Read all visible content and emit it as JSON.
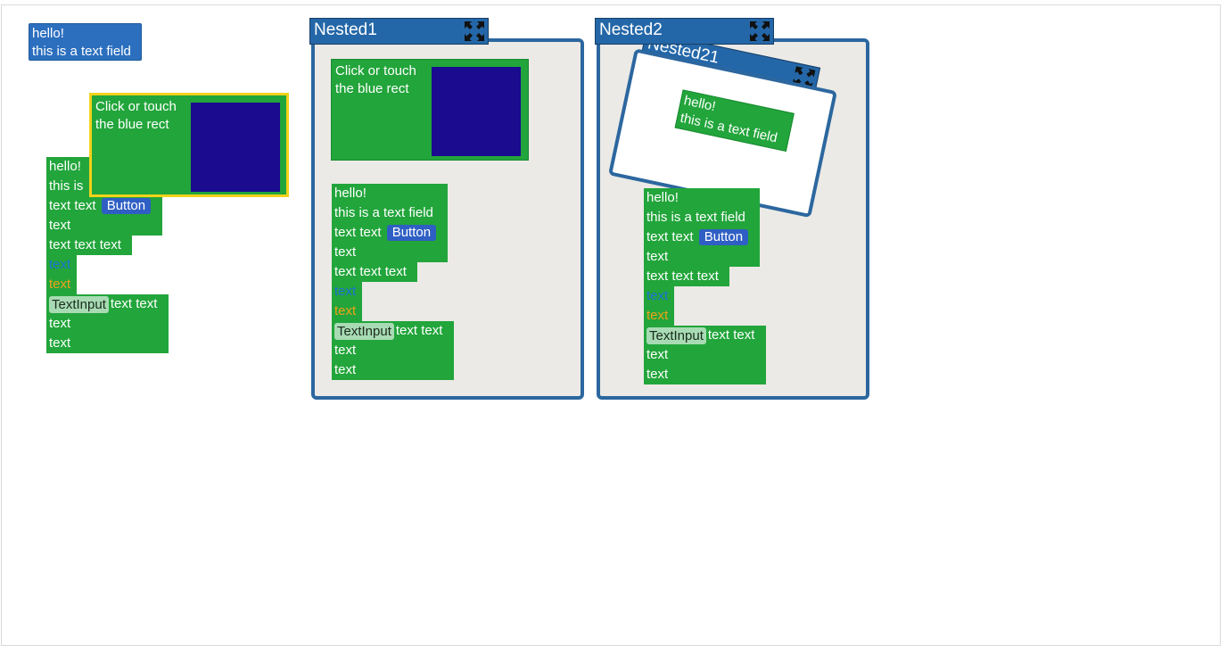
{
  "textfield": {
    "line1": "hello!",
    "line2": "this is a text field"
  },
  "clickrect": {
    "line1": "Click or touch",
    "line2": "the blue rect"
  },
  "list": {
    "line1": "hello!",
    "line2": "this is a text field",
    "line3_text": "text text",
    "button": "Button",
    "line4": "text",
    "line5": "text text text",
    "line6": "text",
    "line7": "text",
    "textinput": "TextInput",
    "line8_text": "text text",
    "line9": "text",
    "line10": "text"
  },
  "list_short_line2": "this is",
  "windows": {
    "nested1": {
      "title": "Nested1"
    },
    "nested2": {
      "title": "Nested2"
    },
    "nested21": {
      "title": "Nested21"
    }
  },
  "icons": {
    "expand": "expand-arrows-icon"
  },
  "colors": {
    "green": "#22a53b",
    "blue_rect": "#1a0b8f",
    "window_title": "#2467a8",
    "highlight": "#f2d21b"
  }
}
